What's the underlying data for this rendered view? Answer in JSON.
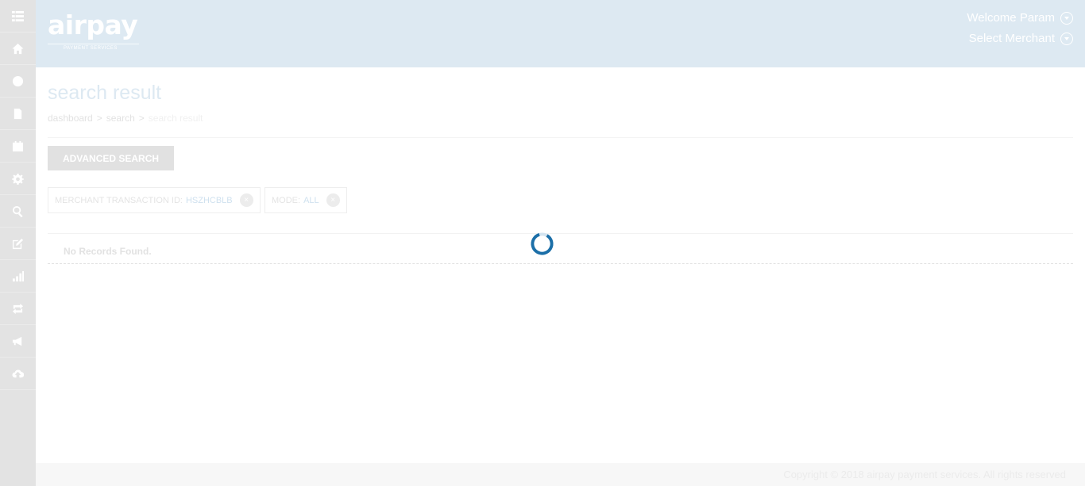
{
  "brand": {
    "name": "airpay",
    "tagline": "PAYMENT SERVICES"
  },
  "header": {
    "welcome": "Welcome Param",
    "select_merchant": "Select Merchant"
  },
  "sidebar": {
    "items": [
      {
        "icon": "menu-icon"
      },
      {
        "icon": "home-icon"
      },
      {
        "icon": "globe-icon"
      },
      {
        "icon": "document-icon"
      },
      {
        "icon": "calendar-icon"
      },
      {
        "icon": "gear-icon"
      },
      {
        "icon": "zoom-search-icon"
      },
      {
        "icon": "edit-icon"
      },
      {
        "icon": "bar-chart-icon"
      },
      {
        "icon": "refresh-icon"
      },
      {
        "icon": "megaphone-icon"
      },
      {
        "icon": "cloud-upload-icon"
      }
    ]
  },
  "page": {
    "title": "search result",
    "breadcrumb": {
      "item1": "dashboard",
      "item2": "search",
      "current": "search result",
      "separator": ">"
    },
    "advanced_search_label": "ADVANCED SEARCH",
    "filters": [
      {
        "label": "MERCHANT TRANSACTION ID:",
        "value": "HSZHCBLB",
        "remove": "×"
      },
      {
        "label": "MODE:",
        "value": "ALL",
        "remove": "×"
      }
    ],
    "no_records": "No Records Found."
  },
  "footer": {
    "copyright": "Copyright © 2018 airpay payment services. All rights reserved"
  },
  "colors": {
    "accent": "#1c6fa8",
    "header_bg": "#dde9f2",
    "sidebar_bg": "#e3e3e3"
  }
}
